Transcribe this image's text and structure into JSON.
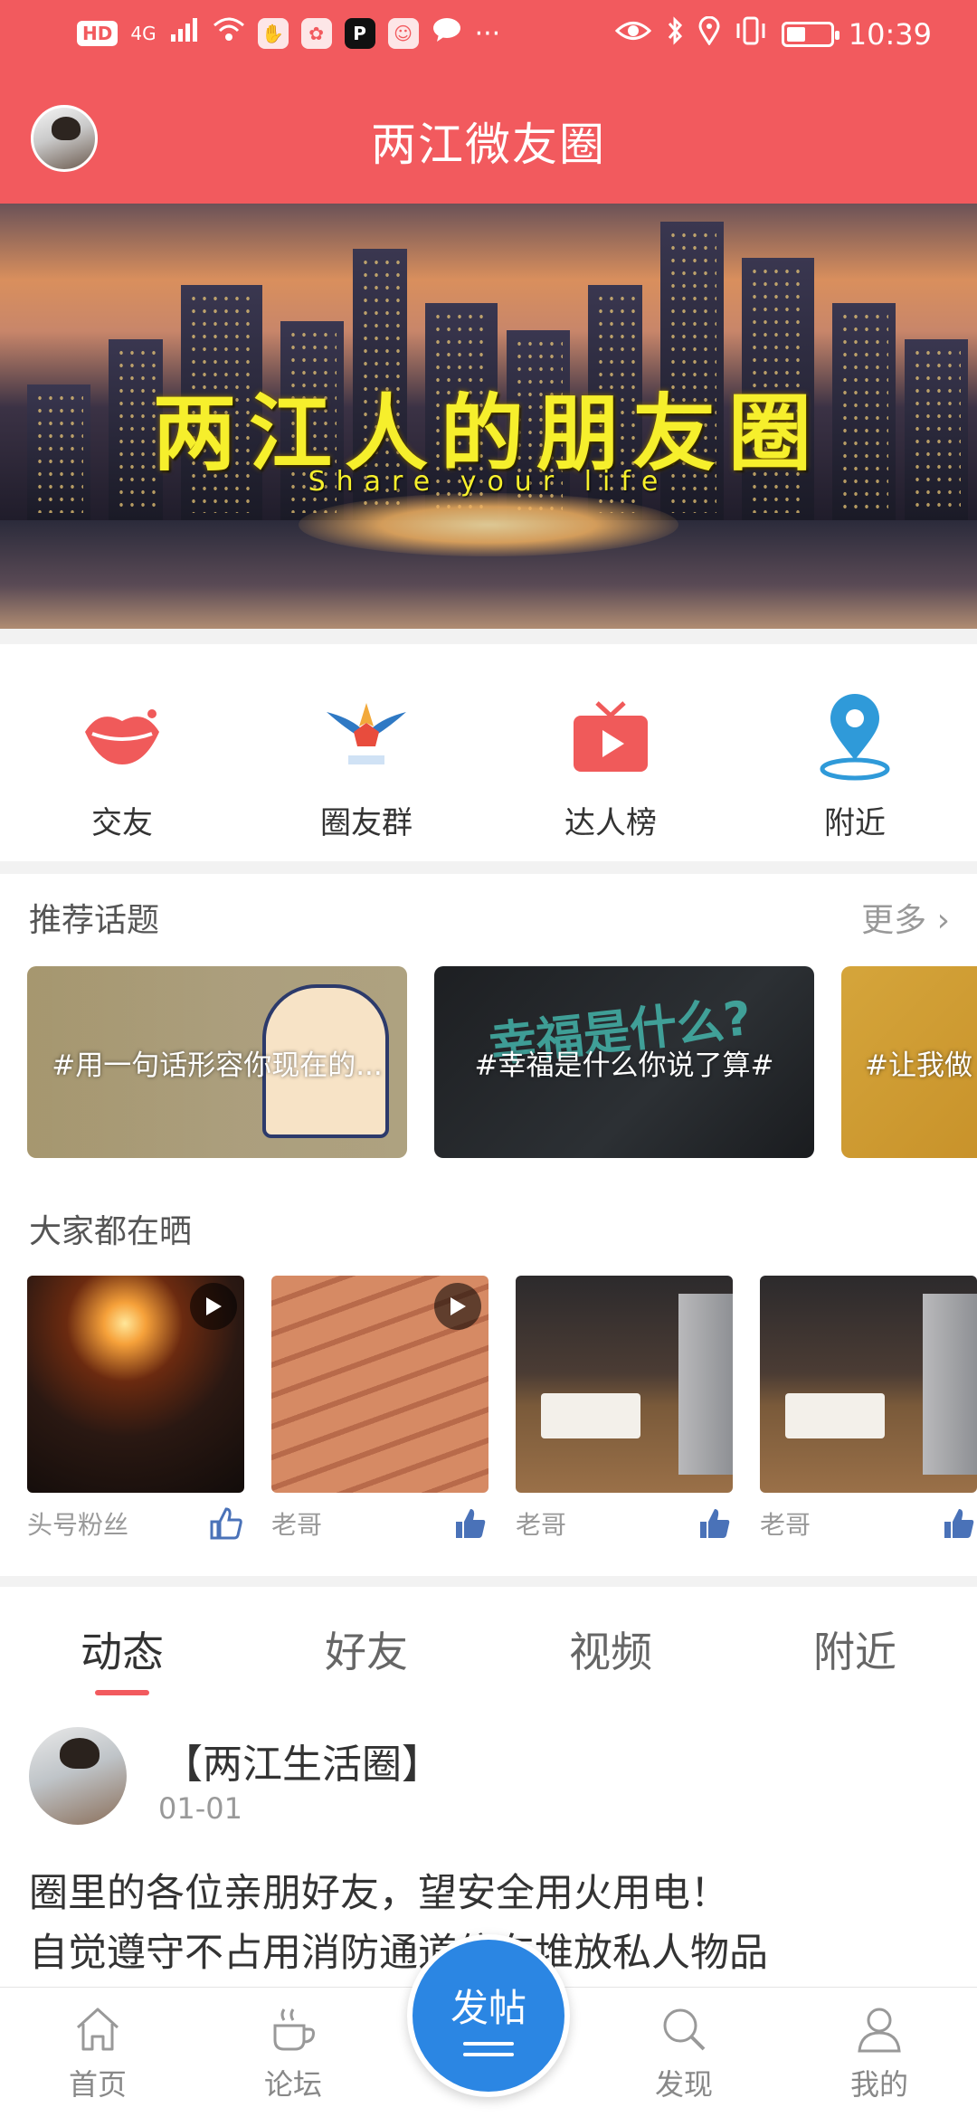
{
  "status_bar": {
    "left_chips": [
      "HD",
      "4G"
    ],
    "time": "10:39",
    "battery_level": 0.35
  },
  "header": {
    "title": "两江微友圈"
  },
  "banner": {
    "title": "两江人的朋友圈",
    "subtitle": "Share your life"
  },
  "quick_menu": [
    {
      "label": "交友",
      "icon": "lips-icon"
    },
    {
      "label": "圈友群",
      "icon": "group-logo-icon"
    },
    {
      "label": "达人榜",
      "icon": "tv-play-icon"
    },
    {
      "label": "附近",
      "icon": "location-pin-icon"
    }
  ],
  "topics": {
    "heading": "推荐话题",
    "more": "更多",
    "items": [
      "#用一句话形容你现在的...",
      "#幸福是什么你说了算#",
      "#让我做"
    ]
  },
  "shares": {
    "heading": "大家都在晒",
    "items": [
      {
        "user": "头号粉丝",
        "video": true,
        "liked": false
      },
      {
        "user": "老哥",
        "video": true,
        "liked": true
      },
      {
        "user": "老哥",
        "video": false,
        "liked": true
      },
      {
        "user": "老哥",
        "video": false,
        "liked": true
      }
    ]
  },
  "feed_tabs": [
    "动态",
    "好友",
    "视频",
    "附近"
  ],
  "post": {
    "author": "【两江生活圈】",
    "date": "01-01",
    "line1": "圈里的各位亲朋好友，望安全用火用电！",
    "line2": "自觉遵守不占用消防通道停车堆放私人物品"
  },
  "bottom_nav": {
    "home": "首页",
    "forum": "论坛",
    "post_button": "发帖",
    "discover": "发现",
    "mine": "我的"
  },
  "colors": {
    "brand_red": "#f25a5e",
    "accent_blue": "#2b86e3"
  }
}
